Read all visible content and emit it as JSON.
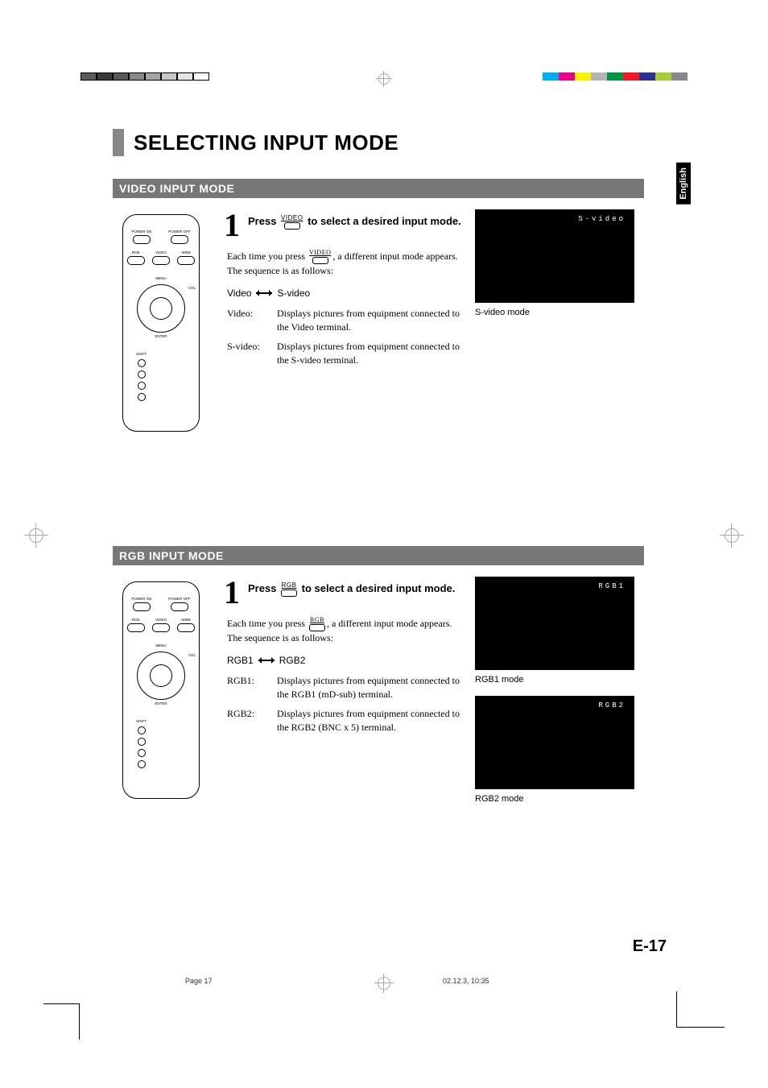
{
  "page_title": "SELECTING INPUT MODE",
  "language_tab": "English",
  "page_number": "E-17",
  "footer": {
    "left": "Page 17",
    "right": "02.12.3, 10:35"
  },
  "color_bar_left": [
    "#5c5c5c",
    "#3a3a3a",
    "#585858",
    "#888888",
    "#a6a6a6",
    "#c8c8c8",
    "#e4e4e4",
    "#ffffff"
  ],
  "color_bar_right": [
    "#00aeef",
    "#ec008c",
    "#fff200",
    "#b3b3b3",
    "#009444",
    "#ed1c24",
    "#2e3192",
    "#a6ce39",
    "#888888"
  ],
  "remote_labels": {
    "power_on": "POWER ON",
    "power_off": "POWER OFF",
    "rgb": "RGB",
    "video": "VIDEO",
    "wide": "WIDE",
    "menu": "MENU",
    "vol": "VOL",
    "enter": "ENTER",
    "shift": "SHIFT"
  },
  "video_section": {
    "heading": "VIDEO INPUT MODE",
    "step_number": "1",
    "step_title_pre": "Press ",
    "step_btn_label": "VIDEO",
    "step_title_post": " to select a desired input mode.",
    "body_pre": "Each time you press ",
    "body_btn_label": "VIDEO",
    "body_post": ", a different input mode appears.  The sequence is as follows:",
    "seq_a": "Video",
    "seq_b": "S-video",
    "defs": [
      {
        "term": "Video:",
        "def": "Displays pictures from equipment connected to the Video terminal."
      },
      {
        "term": "S-video:",
        "def": "Displays pictures from equipment connected to the S-video terminal."
      }
    ],
    "screens": [
      {
        "label": "S-video",
        "caption": "S-video mode"
      }
    ]
  },
  "rgb_section": {
    "heading": "RGB INPUT MODE",
    "step_number": "1",
    "step_title_pre": "Press ",
    "step_btn_label": "RGB",
    "step_title_post": " to select a desired input mode.",
    "body_pre": "Each time you press ",
    "body_btn_label": "RGB",
    "body_post": ", a different input mode appears.  The sequence is as follows:",
    "seq_a": "RGB1",
    "seq_b": "RGB2",
    "defs": [
      {
        "term": "RGB1:",
        "def": "Displays pictures from equipment connected to the RGB1 (mD-sub) terminal."
      },
      {
        "term": "RGB2:",
        "def": "Displays pictures from equipment connected to the RGB2 (BNC x 5) terminal."
      }
    ],
    "screens": [
      {
        "label": "RGB1",
        "caption": "RGB1 mode"
      },
      {
        "label": "RGB2",
        "caption": "RGB2 mode"
      }
    ]
  }
}
